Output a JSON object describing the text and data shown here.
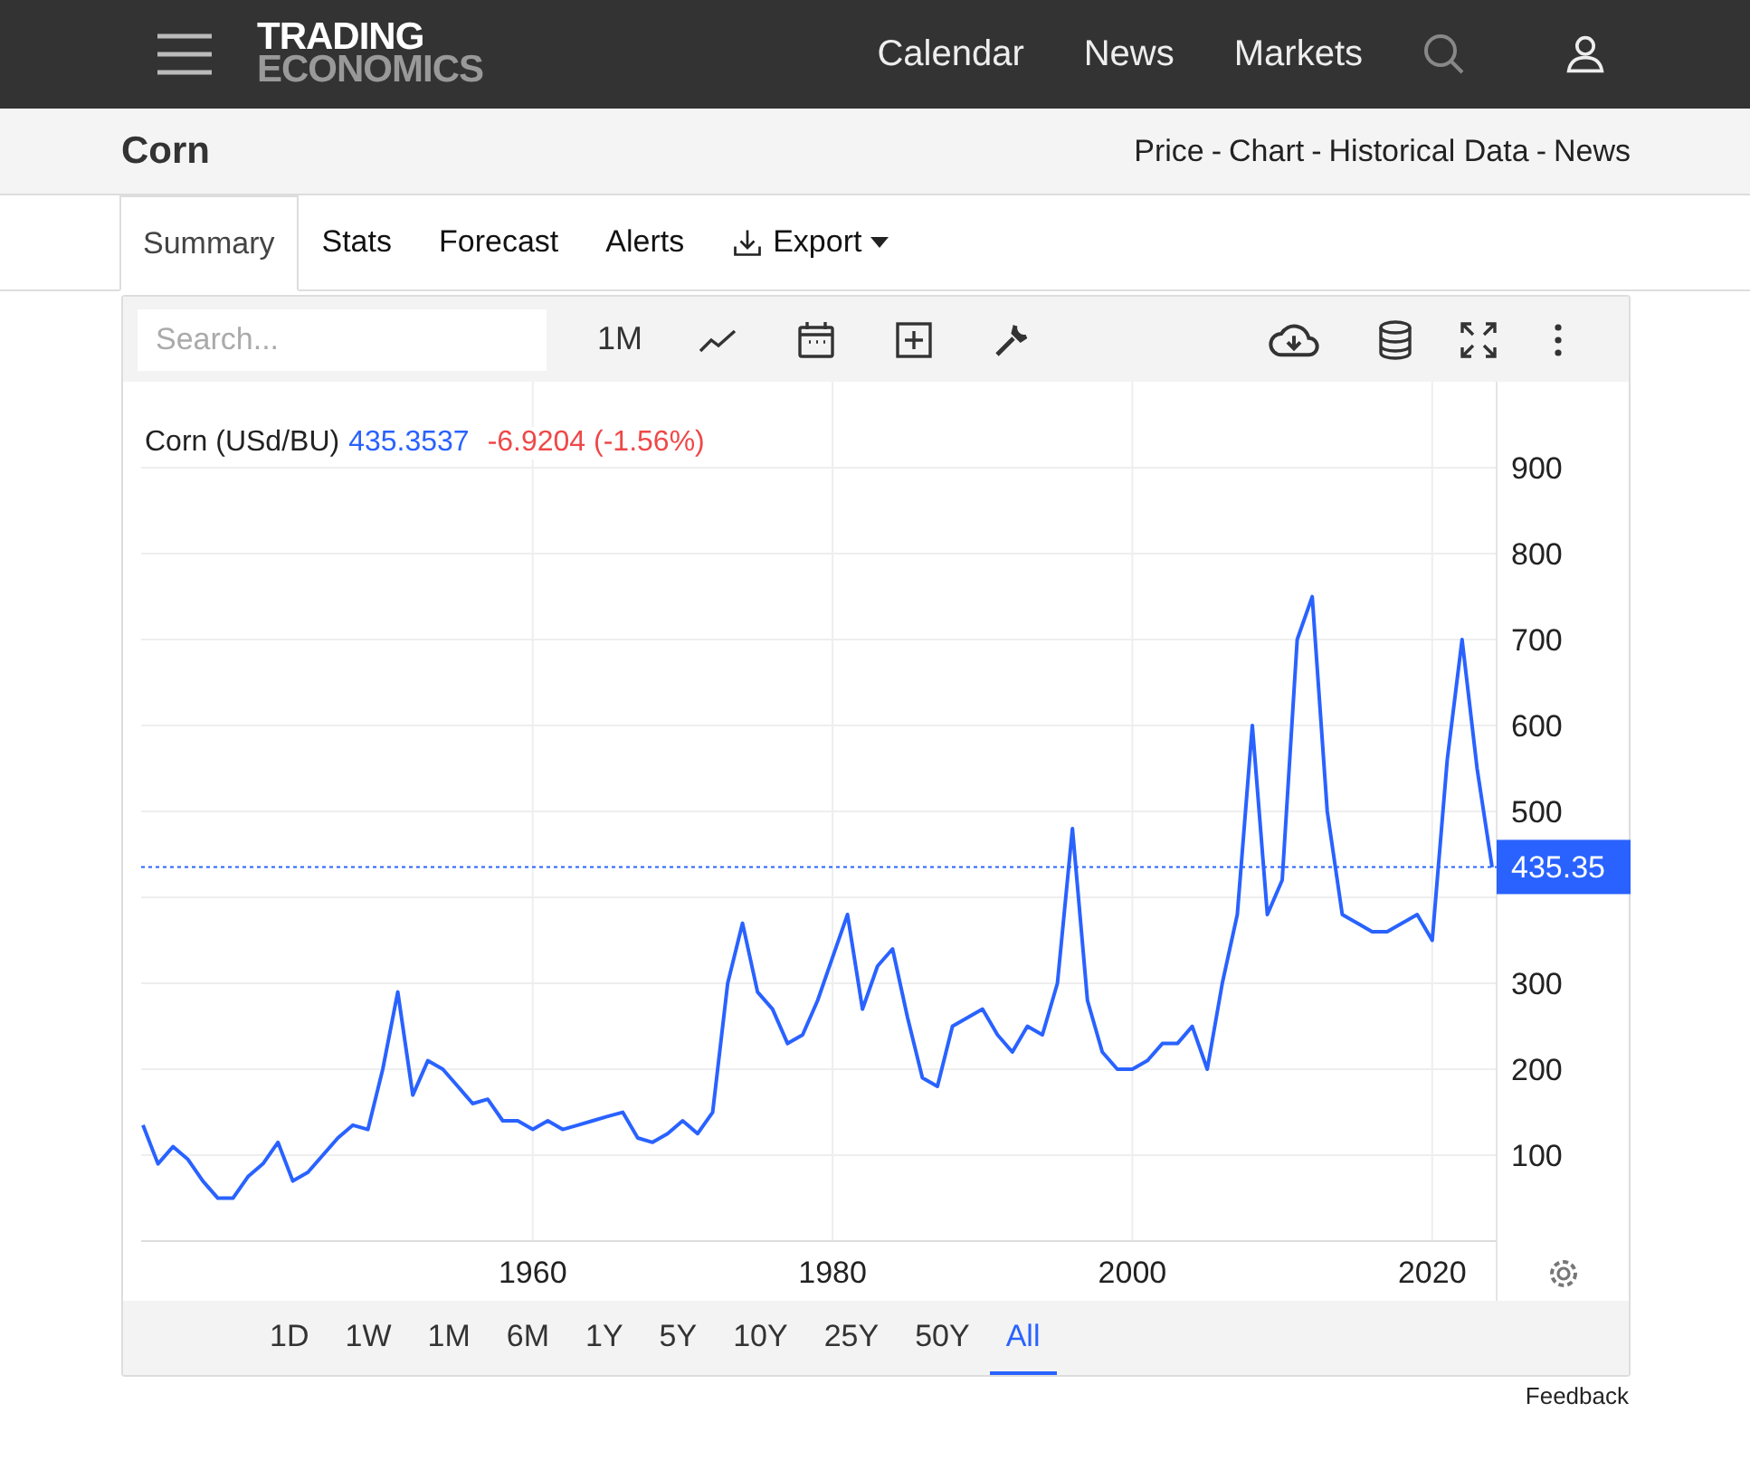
{
  "header": {
    "logo": [
      "TRADING",
      "ECONOMICS"
    ],
    "nav": [
      "Calendar",
      "News",
      "Markets"
    ]
  },
  "page": {
    "title": "Corn",
    "links": [
      "Price",
      "Chart",
      "Historical Data",
      "News"
    ],
    "separator": "-"
  },
  "tabs": [
    {
      "label": "Summary",
      "selected": true,
      "kind": "plain"
    },
    {
      "label": "Stats",
      "selected": false,
      "kind": "plain"
    },
    {
      "label": "Forecast",
      "selected": false,
      "kind": "plain"
    },
    {
      "label": "Alerts",
      "selected": false,
      "kind": "plain"
    },
    {
      "label": "Export",
      "selected": false,
      "kind": "export"
    }
  ],
  "toolbar": {
    "search": {
      "placeholder": "Search..."
    },
    "period": "1M"
  },
  "legend": {
    "name": "Corn (USd/BU)",
    "price": "435.3537",
    "change": "-6.9204 (-1.56%)"
  },
  "chart_data": {
    "type": "line",
    "x": [
      1934,
      1935,
      1936,
      1937,
      1938,
      1939,
      1940,
      1941,
      1942,
      1943,
      1944,
      1945,
      1946,
      1947,
      1948,
      1949,
      1950,
      1951,
      1952,
      1953,
      1954,
      1955,
      1956,
      1957,
      1958,
      1959,
      1960,
      1961,
      1962,
      1963,
      1964,
      1965,
      1966,
      1967,
      1968,
      1969,
      1970,
      1971,
      1972,
      1973,
      1974,
      1975,
      1976,
      1977,
      1978,
      1979,
      1980,
      1981,
      1982,
      1983,
      1984,
      1985,
      1986,
      1987,
      1988,
      1989,
      1990,
      1991,
      1992,
      1993,
      1994,
      1995,
      1996,
      1997,
      1998,
      1999,
      2000,
      2001,
      2002,
      2003,
      2004,
      2005,
      2006,
      2007,
      2008,
      2009,
      2010,
      2011,
      2012,
      2013,
      2014,
      2015,
      2016,
      2017,
      2018,
      2019,
      2020,
      2021,
      2022,
      2023,
      2024
    ],
    "series": [
      {
        "color": "#2962ff",
        "values": [
          135,
          90,
          110,
          95,
          70,
          50,
          50,
          75,
          90,
          115,
          70,
          80,
          100,
          120,
          135,
          130,
          200,
          290,
          170,
          210,
          200,
          180,
          160,
          165,
          140,
          140,
          130,
          140,
          130,
          135,
          140,
          145,
          150,
          120,
          115,
          125,
          140,
          125,
          150,
          300,
          370,
          290,
          270,
          230,
          240,
          280,
          330,
          380,
          270,
          320,
          340,
          260,
          190,
          180,
          250,
          260,
          270,
          240,
          220,
          250,
          240,
          300,
          480,
          280,
          220,
          200,
          200,
          210,
          230,
          230,
          250,
          200,
          300,
          380,
          600,
          380,
          420,
          700,
          750,
          500,
          380,
          370,
          360,
          360,
          370,
          380,
          350,
          560,
          700,
          550,
          435
        ]
      }
    ],
    "xticks": [
      1960,
      1980,
      2000,
      2020
    ],
    "xlim": [
      1934,
      2024.3
    ],
    "grid": true,
    "ref_lines": [
      {
        "axis": "y",
        "value": 435.35,
        "color": "#2962ff",
        "label": "435.35"
      }
    ],
    "yticks": [
      100,
      200,
      300,
      500,
      600,
      700,
      800,
      900
    ],
    "ylim": [
      0,
      1000
    ]
  },
  "ranges": [
    {
      "label": "1D",
      "selected": false
    },
    {
      "label": "1W",
      "selected": false
    },
    {
      "label": "1M",
      "selected": false
    },
    {
      "label": "6M",
      "selected": false
    },
    {
      "label": "1Y",
      "selected": false
    },
    {
      "label": "5Y",
      "selected": false
    },
    {
      "label": "10Y",
      "selected": false
    },
    {
      "label": "25Y",
      "selected": false
    },
    {
      "label": "50Y",
      "selected": false
    },
    {
      "label": "All",
      "selected": true
    }
  ],
  "feedback": "Feedback"
}
